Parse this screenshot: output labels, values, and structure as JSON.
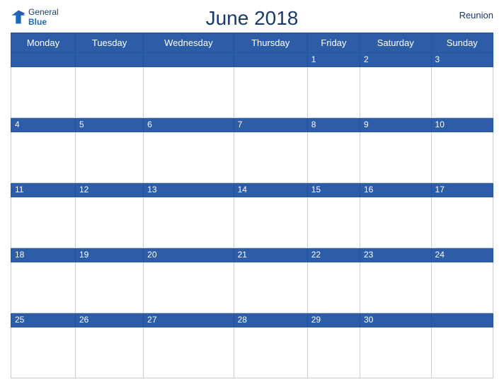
{
  "header": {
    "title": "June 2018",
    "region": "Reunion",
    "logo_general": "General",
    "logo_blue": "Blue"
  },
  "weekdays": [
    "Monday",
    "Tuesday",
    "Wednesday",
    "Thursday",
    "Friday",
    "Saturday",
    "Sunday"
  ],
  "weeks": [
    [
      null,
      null,
      null,
      null,
      1,
      2,
      3
    ],
    [
      4,
      5,
      6,
      7,
      8,
      9,
      10
    ],
    [
      11,
      12,
      13,
      14,
      15,
      16,
      17
    ],
    [
      18,
      19,
      20,
      21,
      22,
      23,
      24
    ],
    [
      25,
      26,
      27,
      28,
      29,
      30,
      null
    ]
  ],
  "colors": {
    "header_bg": "#2e5da8",
    "header_text": "#ffffff",
    "title_color": "#1a3a6b",
    "day_num_color": "#1a3a6b",
    "border": "#cccccc"
  }
}
